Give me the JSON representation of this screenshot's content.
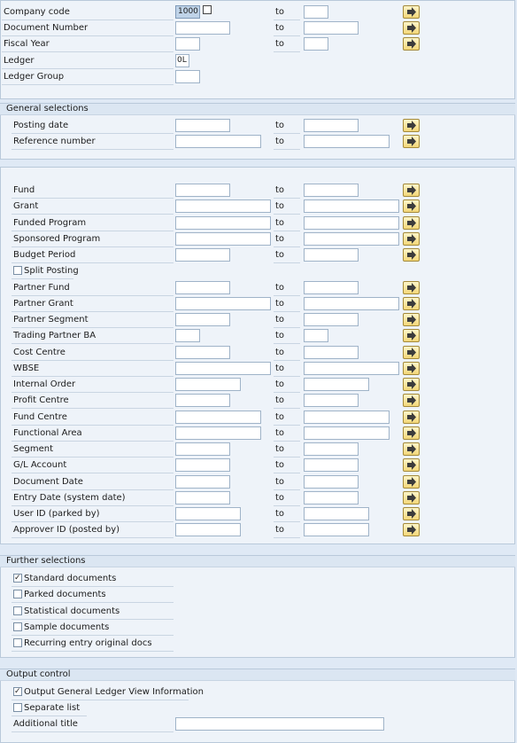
{
  "top": {
    "company_code": {
      "label": "Company code",
      "value": "1000"
    },
    "document_number": {
      "label": "Document Number"
    },
    "fiscal_year": {
      "label": "Fiscal Year"
    },
    "ledger": {
      "label": "Ledger",
      "value": "0L"
    },
    "ledger_group": {
      "label": "Ledger Group"
    }
  },
  "to_label": "to",
  "general": {
    "title": "General selections",
    "posting_date": "Posting date",
    "reference_number": "Reference number"
  },
  "custom": {
    "fields": [
      "Fund",
      "Grant",
      "Funded Program",
      "Sponsored Program",
      "Budget Period",
      "Split Posting",
      "Partner Fund",
      "Partner Grant",
      "Partner Segment",
      "Trading Partner BA",
      "Cost Centre",
      "WBSE",
      "Internal Order",
      "Profit Centre",
      "Fund Centre",
      "Functional Area",
      "Segment",
      "G/L Account",
      "Document Date",
      "Entry Date (system date)",
      "User ID (parked by)",
      "Approver ID (posted by)"
    ]
  },
  "further": {
    "title": "Further selections",
    "options": [
      {
        "label": "Standard documents",
        "checked": true
      },
      {
        "label": "Parked documents",
        "checked": false
      },
      {
        "label": "Statistical documents",
        "checked": false
      },
      {
        "label": "Sample documents",
        "checked": false
      },
      {
        "label": "Recurring entry original docs",
        "checked": false
      }
    ]
  },
  "output": {
    "title": "Output control",
    "gl_view": {
      "label": "Output General Ledger View Information",
      "checked": true
    },
    "separate_list": {
      "label": "Separate list",
      "checked": false
    },
    "additional_title": {
      "label": "Additional title"
    }
  },
  "colors": {
    "background": "#dfe9f5",
    "panel": "#eef3f9",
    "header": "#dbe6f2",
    "multi_button": "#f3d779"
  },
  "icons": {
    "multiple_selection": "arrow-right-icon",
    "possible_entries": "f4-help-icon"
  }
}
